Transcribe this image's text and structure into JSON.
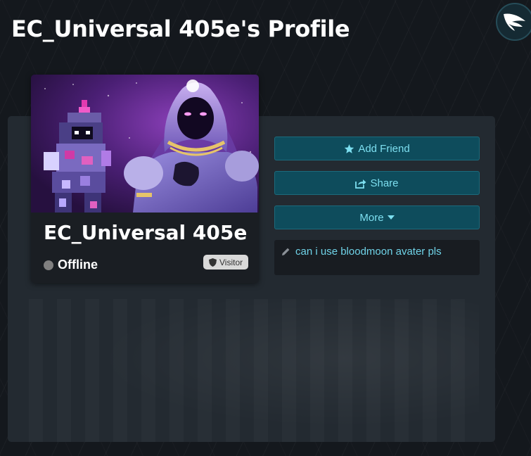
{
  "page": {
    "title": "EC_Universal 405e's Profile"
  },
  "profile": {
    "username": "EC_Universal 405e",
    "status": "Offline",
    "role": "Visitor",
    "bio": "can i use bloodmoon avater pls"
  },
  "actions": {
    "add_friend": "Add Friend",
    "share": "Share",
    "more": "More"
  },
  "icons": {
    "logo": "wing-icon",
    "add_friend": "star-icon",
    "share": "share-icon",
    "more": "caret-down-icon",
    "role": "shield-icon",
    "bio": "pencil-icon"
  },
  "colors": {
    "background": "#14181d",
    "panel": "#232a31",
    "button": "#0e4c5c",
    "button_text": "#7ddff0",
    "bio_text": "#6fd3e8",
    "status_offline": "#808080"
  }
}
